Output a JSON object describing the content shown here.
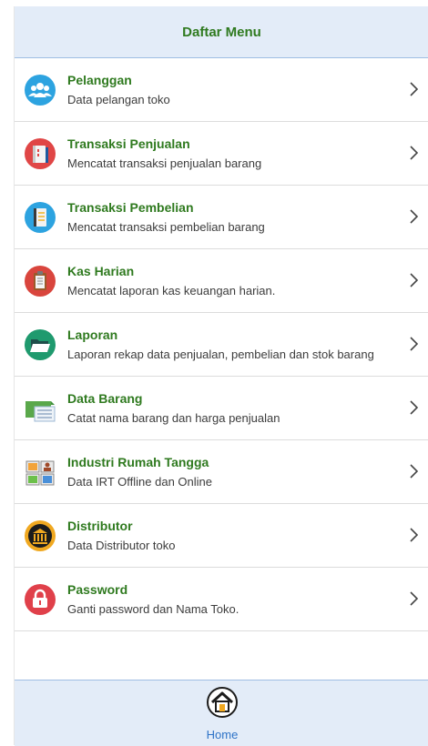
{
  "header": {
    "title": "Daftar Menu"
  },
  "menu": [
    {
      "title": "Pelanggan",
      "subtitle": "Data pelangan toko",
      "icon": "users-icon"
    },
    {
      "title": "Transaksi Penjualan",
      "subtitle": "Mencatat transaksi penjualan barang",
      "icon": "sales-book-icon"
    },
    {
      "title": "Transaksi Pembelian",
      "subtitle": "Mencatat transaksi pembelian barang",
      "icon": "notebook-icon"
    },
    {
      "title": "Kas Harian",
      "subtitle": "Mencatat laporan kas keuangan harian.",
      "icon": "clipboard-icon"
    },
    {
      "title": "Laporan",
      "subtitle": "Laporan rekap data penjualan, pembelian dan stok barang",
      "icon": "folder-icon"
    },
    {
      "title": "Data Barang",
      "subtitle": "Catat nama barang dan harga penjualan",
      "icon": "item-list-icon"
    },
    {
      "title": "Industri Rumah Tangga",
      "subtitle": "Data IRT Offline dan Online",
      "icon": "grid-tiles-icon"
    },
    {
      "title": "Distributor",
      "subtitle": "Data Distributor toko",
      "icon": "bank-icon"
    },
    {
      "title": "Password",
      "subtitle": "Ganti password dan Nama Toko.",
      "icon": "lock-icon"
    }
  ],
  "footer": {
    "home_label": "Home",
    "icon": "home-icon"
  },
  "colors": {
    "title_green": "#2f7a1f",
    "header_bg": "#e3ecf8",
    "home_blue": "#2e73c7"
  }
}
